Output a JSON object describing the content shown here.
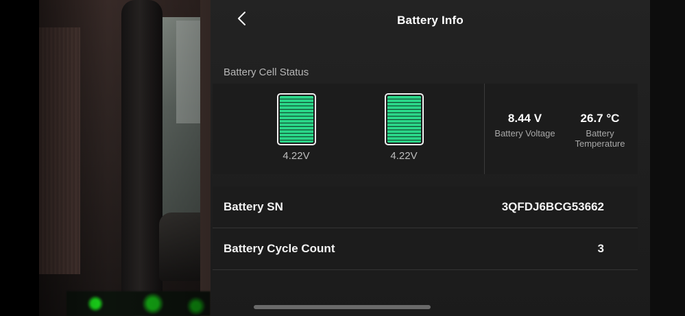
{
  "header": {
    "title": "Battery Info",
    "back_icon": "chevron-left-icon"
  },
  "cell_status": {
    "label": "Battery Cell Status",
    "cells": [
      {
        "voltage": "4.22V",
        "level": 1.0
      },
      {
        "voltage": "4.22V",
        "level": 1.0
      }
    ],
    "voltage": {
      "value": "8.44 V",
      "label": "Battery Voltage"
    },
    "temperature": {
      "value": "26.7 °C",
      "label": "Battery\nTemperature"
    }
  },
  "info": {
    "sn": {
      "label": "Battery SN",
      "value": "3QFDJ6BCG53662"
    },
    "cycle_count": {
      "label": "Battery Cycle Count",
      "value": "3"
    }
  },
  "colors": {
    "cell_fill": "#2ad487",
    "panel_bg": "#1c1c1c"
  }
}
